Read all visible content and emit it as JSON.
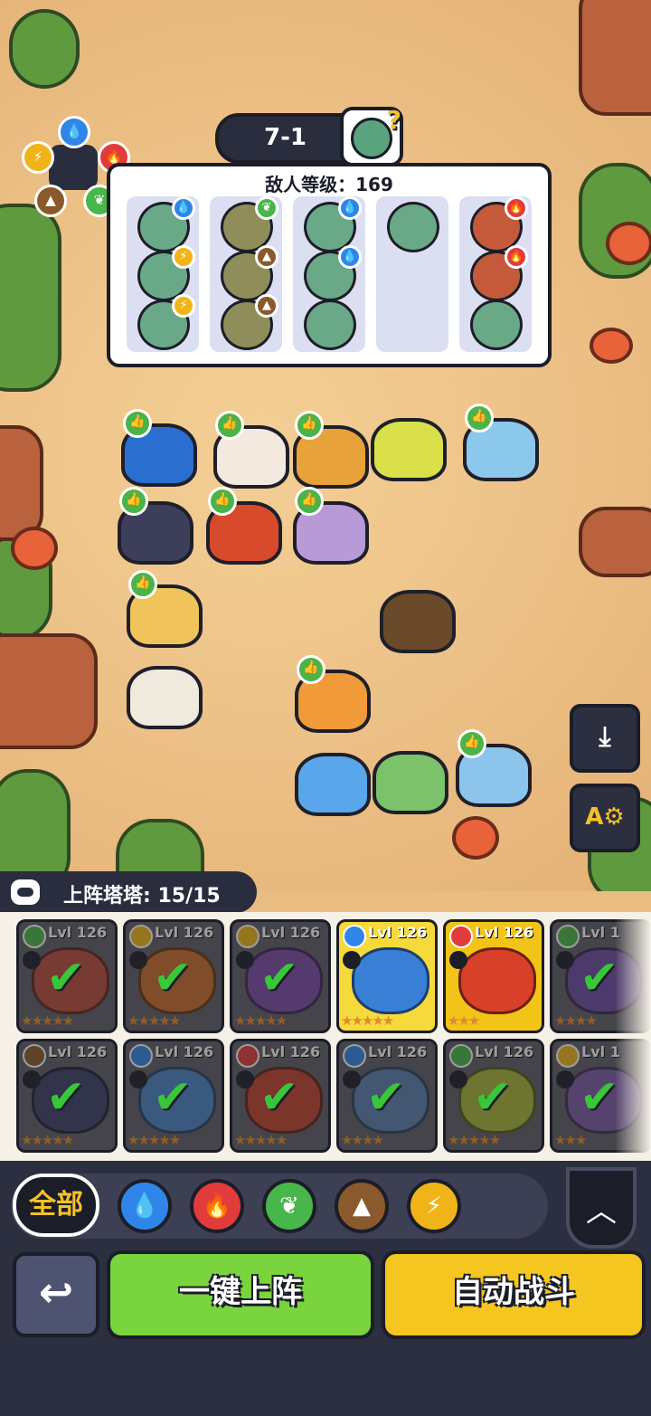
{
  "stage": {
    "label": "7-1",
    "boss_icon": "zombie-question-icon"
  },
  "enemy_panel": {
    "title": "敌人等级：169",
    "columns": [
      [
        "water",
        "lightning",
        "lightning"
      ],
      [
        "leaf",
        "earth",
        "earth"
      ],
      [
        "water",
        "water",
        "none"
      ],
      [
        "none"
      ],
      [
        "fire",
        "fire",
        "none"
      ]
    ]
  },
  "element_wheel": [
    "water",
    "fire",
    "leaf",
    "earth",
    "lightning"
  ],
  "team": {
    "label": "上阵塔塔: 15/15"
  },
  "roster": [
    {
      "level": "Lvl 126",
      "element": "leaf",
      "deployed": true,
      "stars": "★★★★★",
      "color": "#b84b3c"
    },
    {
      "level": "Lvl 126",
      "element": "lightning",
      "deployed": true,
      "stars": "★★★★★",
      "color": "#c86a2a"
    },
    {
      "level": "Lvl 126",
      "element": "lightning",
      "deployed": true,
      "stars": "★★★★★",
      "color": "#7a4aa8"
    },
    {
      "level": "Lvl 126",
      "element": "water",
      "deployed": false,
      "stars": "★★★★★",
      "color": "#3a7fd6"
    },
    {
      "level": "Lvl 126",
      "element": "fire",
      "deployed": false,
      "stars": "★★★",
      "color": "#d9402a"
    },
    {
      "level": "Lvl 1",
      "element": "leaf",
      "deployed": true,
      "stars": "★★★★",
      "color": "#6a4aa0"
    },
    {
      "level": "Lvl 126",
      "element": "earth",
      "deployed": true,
      "stars": "★★★★★",
      "color": "#3b3f6b"
    },
    {
      "level": "Lvl 126",
      "element": "water",
      "deployed": true,
      "stars": "★★★★★",
      "color": "#4a82c6"
    },
    {
      "level": "Lvl 126",
      "element": "fire",
      "deployed": true,
      "stars": "★★★★★",
      "color": "#c0402e"
    },
    {
      "level": "Lvl 126",
      "element": "water",
      "deployed": true,
      "stars": "★★★★",
      "color": "#5a7cb0"
    },
    {
      "level": "Lvl 126",
      "element": "leaf",
      "deployed": true,
      "stars": "★★★★★",
      "color": "#a6b53a"
    },
    {
      "level": "Lvl 1",
      "element": "lightning",
      "deployed": true,
      "stars": "★★★",
      "color": "#7a5aa8"
    }
  ],
  "filters": {
    "all_label": "全部",
    "elements": [
      {
        "name": "water",
        "glyph": "💧",
        "color": "#2f86e8"
      },
      {
        "name": "fire",
        "glyph": "🔥",
        "color": "#e23b3b"
      },
      {
        "name": "leaf",
        "glyph": "❦",
        "color": "#48b64a"
      },
      {
        "name": "earth",
        "glyph": "▲",
        "color": "#8a5a2c"
      },
      {
        "name": "lightning",
        "glyph": "⚡",
        "color": "#f1b418"
      }
    ]
  },
  "buttons": {
    "back": "↩",
    "deploy": "一键上阵",
    "auto_battle": "自动战斗",
    "download": "⤓",
    "auto_settings": "A⚙"
  },
  "element_colors": {
    "water": "#2f86e8",
    "fire": "#e23b3b",
    "leaf": "#48b64a",
    "earth": "#8a5a2c",
    "lightning": "#f1b418",
    "none": "transparent"
  },
  "field_units": [
    {
      "name": "toucan",
      "color": "#2a6fd0",
      "thumb": true
    },
    {
      "name": "chicken",
      "color": "#f3e9df",
      "thumb": true
    },
    {
      "name": "fox-cub",
      "color": "#e8a23a",
      "thumb": true
    },
    {
      "name": "pear-twins",
      "color": "#d9e04a",
      "thumb": false
    },
    {
      "name": "ice-sprite",
      "color": "#8cc8ec",
      "thumb": true
    },
    {
      "name": "dino",
      "color": "#3d3f5a",
      "thumb": true
    },
    {
      "name": "lava-toad",
      "color": "#d84a2c",
      "thumb": true
    },
    {
      "name": "purple-cat",
      "color": "#b99ad8",
      "thumb": true
    },
    {
      "name": "griffin",
      "color": "#f0c45a",
      "thumb": true
    },
    {
      "name": "caged-pet",
      "color": "#6a4a2a",
      "thumb": false
    },
    {
      "name": "sprout-bird",
      "color": "#efe9de",
      "thumb": false
    },
    {
      "name": "flame-deer",
      "color": "#f09a3a",
      "thumb": true
    },
    {
      "name": "blue-ghost",
      "color": "#5aa6ea",
      "thumb": false
    },
    {
      "name": "flower-frog",
      "color": "#7cc26a",
      "thumb": false
    },
    {
      "name": "ice-bear",
      "color": "#8cc4ec",
      "thumb": true
    }
  ]
}
